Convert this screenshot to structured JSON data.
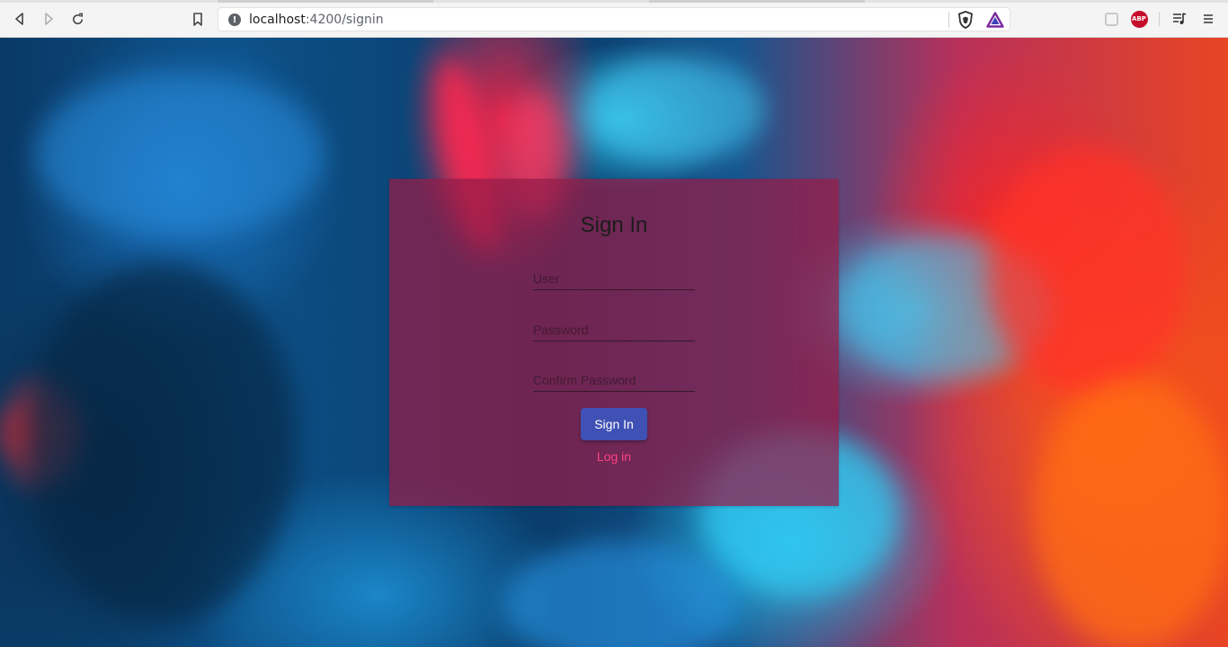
{
  "browser": {
    "url_host": "localhost",
    "url_path": ":4200/signin",
    "abp_label": "ABP"
  },
  "signin": {
    "title": "Sign In",
    "user_placeholder": "User",
    "password_placeholder": "Password",
    "confirm_placeholder": "Confirm Password",
    "submit_label": "Sign In",
    "login_link": "Log in"
  },
  "colors": {
    "primary": "#3f51b5",
    "accent": "#ff4081",
    "card": "rgba(150,28,72,0.72)"
  },
  "icons": [
    "back-icon",
    "forward-icon",
    "reload-icon",
    "bookmark-icon",
    "info-icon",
    "brave-shields-icon",
    "brave-rewards-icon",
    "extension-icon",
    "adblock-icon",
    "media-icon",
    "menu-icon"
  ]
}
